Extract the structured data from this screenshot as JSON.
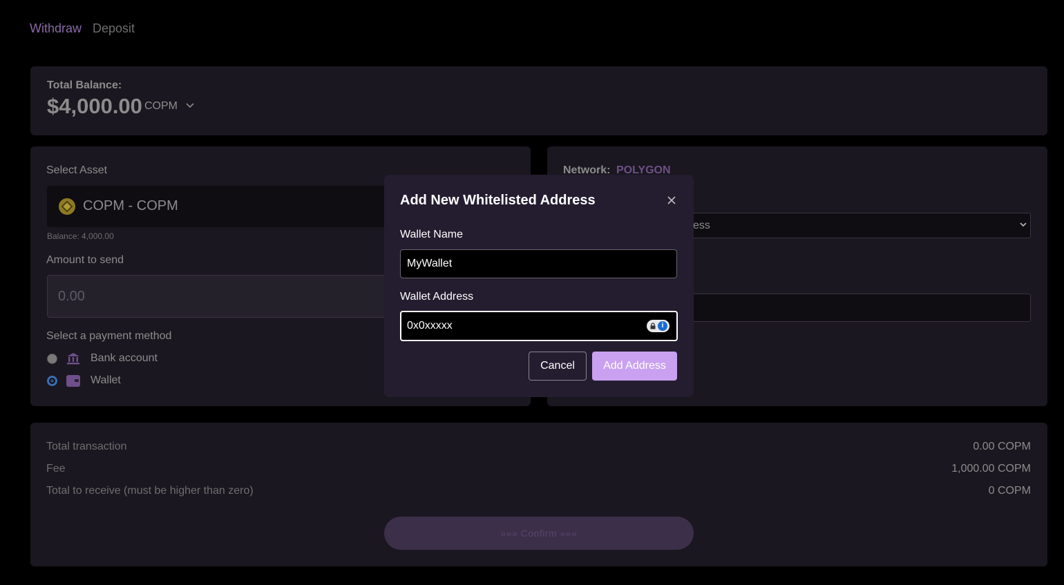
{
  "tabs": {
    "withdraw": "Withdraw",
    "deposit": "Deposit"
  },
  "balance": {
    "label": "Total Balance:",
    "value": "$4,000.00",
    "currency": "COPM"
  },
  "asset": {
    "label": "Select Asset",
    "selected": "COPM - COPM",
    "balance_note": "Balance: 4,000.00"
  },
  "amount": {
    "label": "Amount to send",
    "placeholder": "0.00"
  },
  "payment": {
    "label": "Select a payment method",
    "options": [
      {
        "label": "Bank account",
        "selected": false
      },
      {
        "label": "Wallet",
        "selected": true
      }
    ]
  },
  "network": {
    "label": "Network:",
    "value": "POLYGON",
    "address_select_visible": "ess"
  },
  "summary": {
    "rows": [
      {
        "label": "Total transaction",
        "value": "0.00 COPM"
      },
      {
        "label": "Fee",
        "value": "1,000.00 COPM"
      },
      {
        "label": "Total to receive (must be higher than zero)",
        "value": "0 COPM"
      }
    ],
    "confirm": "»»»   Confirm   «««"
  },
  "modal": {
    "title": "Add New Whitelisted Address",
    "wallet_name_label": "Wallet Name",
    "wallet_name_value": "MyWallet",
    "wallet_address_label": "Wallet Address",
    "wallet_address_value": "0x0xxxxx",
    "cancel": "Cancel",
    "add": "Add Address"
  },
  "colors": {
    "background": "#000000",
    "card": "#1a1720",
    "modal": "#241d30",
    "accent": "#c9a1f0",
    "network_accent": "#6e5088"
  },
  "icons": [
    "chevron-down-icon",
    "coin-icon",
    "bank-icon",
    "wallet-icon",
    "close-icon",
    "password-manager-icon"
  ]
}
